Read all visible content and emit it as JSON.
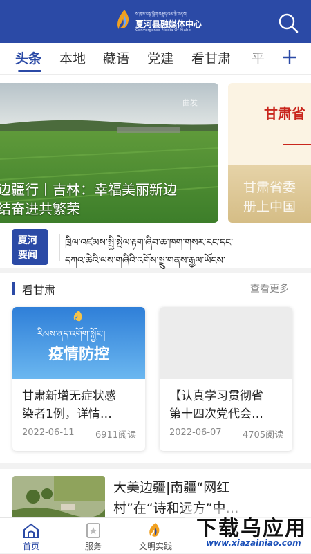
{
  "header": {
    "logo_tibetan": "ས་ཁུལ་བསྡུ་སྒྲིག་བརྒྱུད་ལམ་ལྟེ་གནས།",
    "logo_cn": "夏河县融媒体中心",
    "logo_en": "Convergence Media Of Xiahe"
  },
  "tabs": [
    "头条",
    "本地",
    "藏语",
    "党建",
    "看甘肃",
    "平"
  ],
  "banner": {
    "main_watermark": "曲发",
    "main_line1": "边疆行丨吉林：幸福美丽新边",
    "main_line2": "结奋进共繁荣",
    "next_title": "甘肃省",
    "next_line1": "甘肃省委",
    "next_line2": "册上中国"
  },
  "news": {
    "badge_line1": "夏河",
    "badge_line2": "要闻",
    "ticker_line1": "ཁྲིལ་འཛམས་སྤྱི་སྤེལ་རྟག་ཞིབ་ཆ་ཁག་གསར་རང་དང་",
    "ticker_line2": "དཀའ་ཆེའི་ལས་གཞིའི་འགོས་སྤྲུ་གནས་རྒྱལ་ཡོངས་"
  },
  "section": {
    "title": "看甘肃",
    "more": "查看更多",
    "cards": [
      {
        "img_tibetan": "རིམས་ནད་འགོག་སྐྱོང་།",
        "img_caption": "疫情防控",
        "title_line1": "甘肃新增无症状感",
        "title_line2": "染者1例，详情…",
        "date": "2022-06-11",
        "views": "6911阅读"
      },
      {
        "title_line1": "【认真学习贯彻省",
        "title_line2": "第十四次党代会…",
        "date": "2022-06-07",
        "views": "4705阅读"
      }
    ]
  },
  "list_item": {
    "title_line1": "大美边疆|南疆“网红",
    "title_line2": "村”在“诗和远方”中…"
  },
  "bottom_nav": [
    {
      "label": "首页",
      "icon": "home-icon",
      "active": true
    },
    {
      "label": "服务",
      "icon": "star-icon"
    },
    {
      "label": "文明实践",
      "icon": "flame-logo-icon"
    }
  ],
  "watermark": {
    "cn": "下载乌应用",
    "url": "www.xiazainiao.com"
  },
  "colors": {
    "brand": "#2b4aa6",
    "accent_red": "#c9261d"
  }
}
